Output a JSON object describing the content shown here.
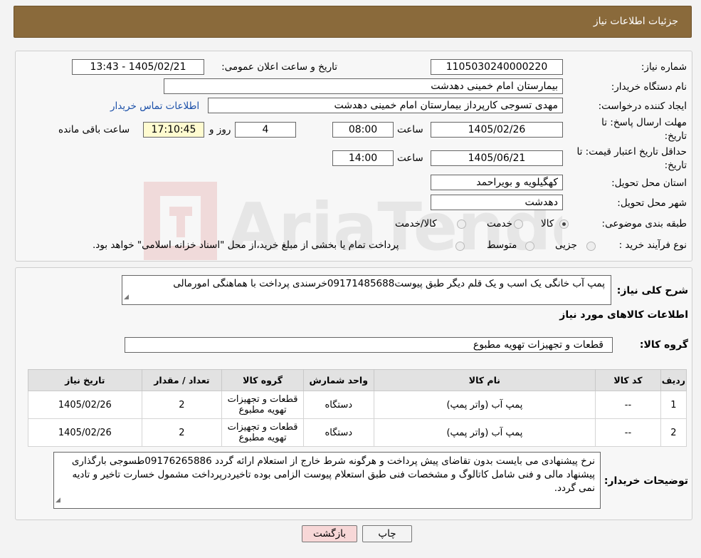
{
  "header": {
    "title": "جزئیات اطلاعات نیاز"
  },
  "form": {
    "need_number": {
      "label": "شماره نیاز:",
      "value": "1105030240000220"
    },
    "announce": {
      "label": "تاریخ و ساعت اعلان عمومی:",
      "value": "1405/02/21 - 13:43"
    },
    "buyer_org": {
      "label": "نام دستگاه خریدار:",
      "value": "بیمارستان امام خمینی دهدشت"
    },
    "requester": {
      "label": "ایجاد کننده درخواست:",
      "value": "مهدی تسوجی کارپرداز بیمارستان امام خمینی دهدشت",
      "contact_link": "اطلاعات تماس خریدار"
    },
    "deadline": {
      "label_line1": "مهلت ارسال پاسخ: تا",
      "label_line2": "تاریخ:",
      "date": "1405/02/26",
      "time_label": "ساعت",
      "time": "08:00",
      "days": "4",
      "days_label": "روز و",
      "remaining": "17:10:45",
      "remaining_label": "ساعت باقی مانده"
    },
    "validity": {
      "label_line1": "حداقل تاریخ اعتبار قیمت: تا",
      "label_line2": "تاریخ:",
      "date": "1405/06/21",
      "time_label": "ساعت",
      "time": "14:00"
    },
    "province": {
      "label": "استان محل تحویل:",
      "value": "کهگیلویه و بویراحمد"
    },
    "city": {
      "label": "شهر محل تحویل:",
      "value": "دهدشت"
    },
    "category": {
      "label": "طبقه بندی موضوعی:",
      "options": [
        "کالا",
        "خدمت",
        "کالا/خدمت"
      ],
      "selected": "کالا"
    },
    "purchase_type": {
      "label": "نوع فرآیند خرید :",
      "options": [
        "جزیی",
        "متوسط"
      ],
      "note": "پرداخت تمام یا بخشی از مبلغ خرید،از محل \"اسناد خزانه اسلامی\" خواهد بود."
    }
  },
  "watermark": {
    "text": "AriaTender.neT"
  },
  "description": {
    "label": "شرح کلی نیاز:",
    "value": "پمپ  آب خانگی یک اسب و یک قلم دیگر طبق پیوست09171485688خرسندی پرداخت با هماهنگی امورمالی"
  },
  "goods_info": {
    "title": "اطلاعات کالاهای مورد نیاز",
    "group_label": "گروه کالا:",
    "group_value": "قطعات و تجهیزات تهویه مطبوع"
  },
  "table": {
    "headers": [
      "ردیف",
      "کد کالا",
      "نام کالا",
      "واحد شمارش",
      "گروه کالا",
      "تعداد / مقدار",
      "تاریخ نیاز"
    ],
    "rows": [
      {
        "row": "1",
        "code": "--",
        "name": "پمپ آب (واتر پمپ)",
        "unit": "دستگاه",
        "group_line1": "قطعات و تجهیزات",
        "group_line2": "تهویه مطبوع",
        "qty": "2",
        "date": "1405/02/26"
      },
      {
        "row": "2",
        "code": "--",
        "name": "پمپ آب (واتر پمپ)",
        "unit": "دستگاه",
        "group_line1": "قطعات و تجهیزات",
        "group_line2": "تهویه مطبوع",
        "qty": "2",
        "date": "1405/02/26"
      }
    ]
  },
  "buyer_notes": {
    "label": "توضیحات خریدار:",
    "value": "نرخ پیشنهادی می بایست بدون تقاضای پیش پرداخت و هرگونه شرط خارج از استعلام ارائه گردد 09176265886طسوجی بارگذاری پیشنهاد مالی و فنی شامل کاتالوگ و مشخصات فنی طبق استعلام پیوست الزامی بوده تاخیردرپرداخت مشمول خسارت تاخیر و تادیه نمی گردد."
  },
  "buttons": {
    "print": "چاپ",
    "back": "بازگشت"
  },
  "colors": {
    "header": "#8a6a3b",
    "link": "#1a4fa8",
    "back_button": "#f7d7d7",
    "timer_bg": "#fffbd0"
  }
}
